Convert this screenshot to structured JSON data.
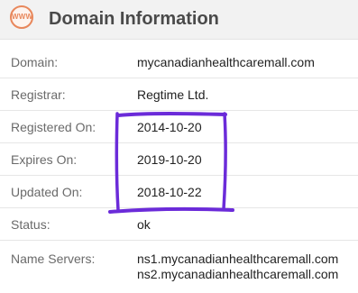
{
  "header": {
    "badge_text": "WWW",
    "title": "Domain Information"
  },
  "rows": [
    {
      "label": "Domain:",
      "value": "mycanadianhealthcaremall.com"
    },
    {
      "label": "Registrar:",
      "value": "Regtime Ltd."
    },
    {
      "label": "Registered On:",
      "value": "2014-10-20"
    },
    {
      "label": "Expires On:",
      "value": "2019-10-20"
    },
    {
      "label": "Updated On:",
      "value": "2018-10-22"
    },
    {
      "label": "Status:",
      "value": "ok"
    }
  ],
  "name_servers": {
    "label": "Name Servers:",
    "values": [
      "ns1.mycanadianhealthcaremall.com",
      "ns2.mycanadianhealthcaremall.com"
    ]
  },
  "colors": {
    "header_bg": "#f2f2f2",
    "badge_accent": "#e8875b",
    "highlight_marker": "#6b2bd9"
  }
}
